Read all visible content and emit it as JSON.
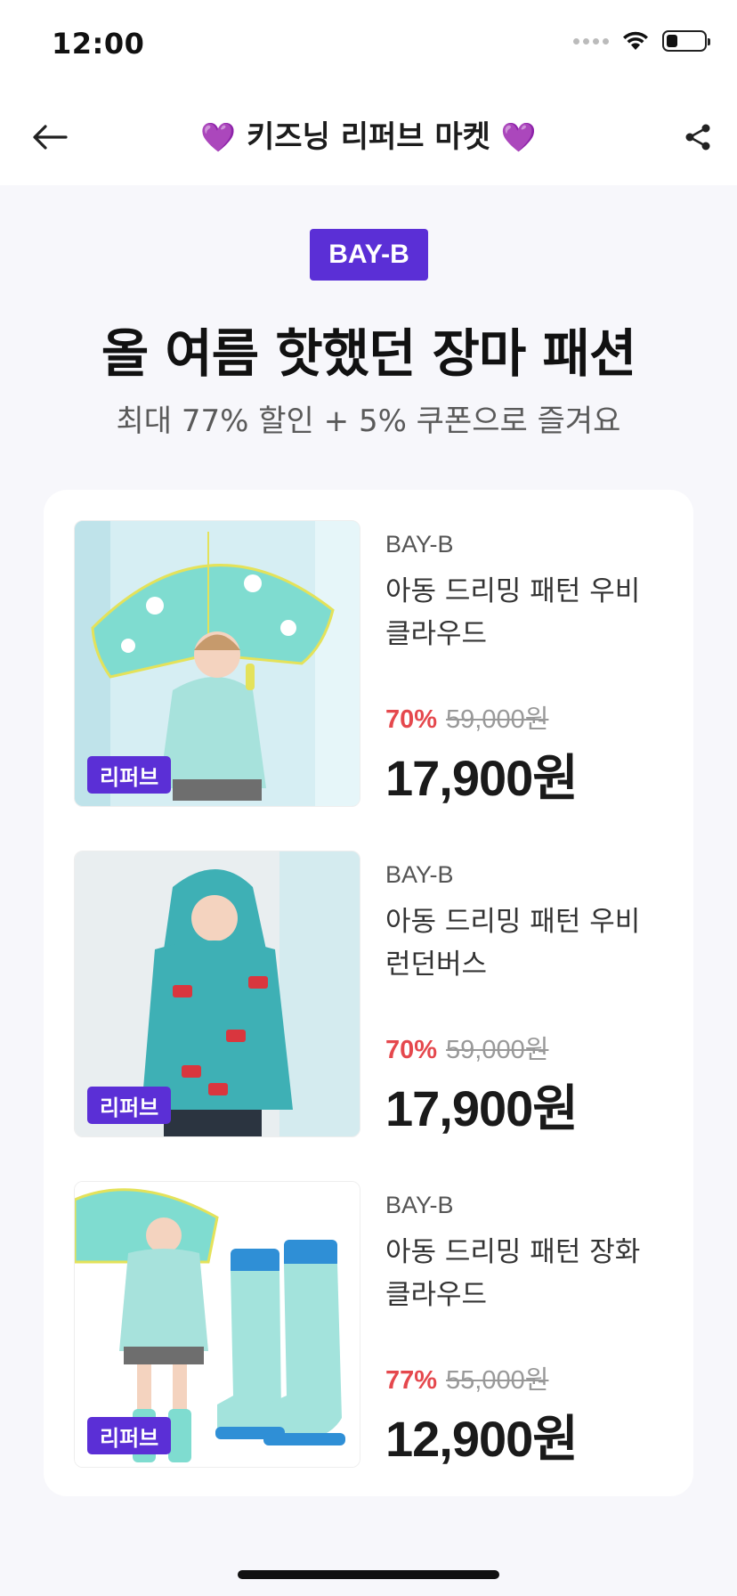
{
  "status_bar": {
    "time": "12:00"
  },
  "nav": {
    "title": "키즈닝 리퍼브 마켓",
    "heart": "💜"
  },
  "header": {
    "brand_badge": "BAY-B",
    "headline": "올 여름 핫했던 장마 패션",
    "subline": "최대 77% 할인 + 5% 쿠폰으로 즐겨요"
  },
  "products": [
    {
      "brand": "BAY-B",
      "name": "아동 드리밍 패턴 우비 클라우드",
      "discount": "70%",
      "original_price": "59,000원",
      "price": "17,900원",
      "tag": "리퍼브"
    },
    {
      "brand": "BAY-B",
      "name": "아동 드리밍 패턴 우비 런던버스",
      "discount": "70%",
      "original_price": "59,000원",
      "price": "17,900원",
      "tag": "리퍼브"
    },
    {
      "brand": "BAY-B",
      "name": "아동 드리밍 패턴 장화 클라우드",
      "discount": "77%",
      "original_price": "55,000원",
      "price": "12,900원",
      "tag": "리퍼브"
    }
  ],
  "colors": {
    "accent": "#5b2fd6",
    "discount": "#e5484d",
    "background": "#f7f7fb"
  },
  "icons": [
    "back-arrow-icon",
    "share-icon",
    "wifi-icon",
    "battery-icon",
    "signal-icon"
  ]
}
